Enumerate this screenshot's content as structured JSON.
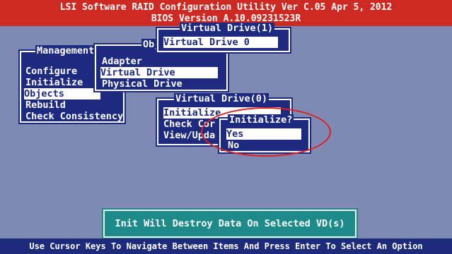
{
  "title": {
    "line1": "LSI Software RAID Configuration Utility Ver C.05 Apr 5, 2012",
    "line2": "BIOS Version   A.10.09231523R"
  },
  "management": {
    "title": "Management",
    "items": [
      "Configure",
      "Initialize",
      "Objects",
      "Rebuild",
      "Check Consistency"
    ],
    "selected": "Objects"
  },
  "objects": {
    "title": "Obj",
    "items": [
      "Adapter",
      "Virtual Drive",
      "Physical Drive"
    ],
    "selected": "Virtual Drive"
  },
  "virtual_drive_list": {
    "title": "Virtual Drive(1)",
    "items": [
      "Virtual Drive 0"
    ],
    "selected": "Virtual Drive 0"
  },
  "virtual_drive_menu": {
    "title": "Virtual Drive(0)",
    "items": [
      "Initialize",
      "Check Cor",
      "View/Upda"
    ],
    "selected": "Initialize"
  },
  "initialize_dialog": {
    "title": "Initialize?",
    "items": [
      "Yes",
      "No"
    ],
    "selected": "Yes"
  },
  "message": "Init Will Destroy Data On Selected VD(s)",
  "status": "Use Cursor Keys To Navigate Between Items And Press Enter To Select An Option",
  "colors": {
    "background": "#7f8ab4",
    "title_bar": "#cc2a22",
    "window": "#1d2a80",
    "message_box": "#1e8a8a",
    "dialog_title": "#ffff00",
    "highlight_ellipse": "#e02020"
  }
}
